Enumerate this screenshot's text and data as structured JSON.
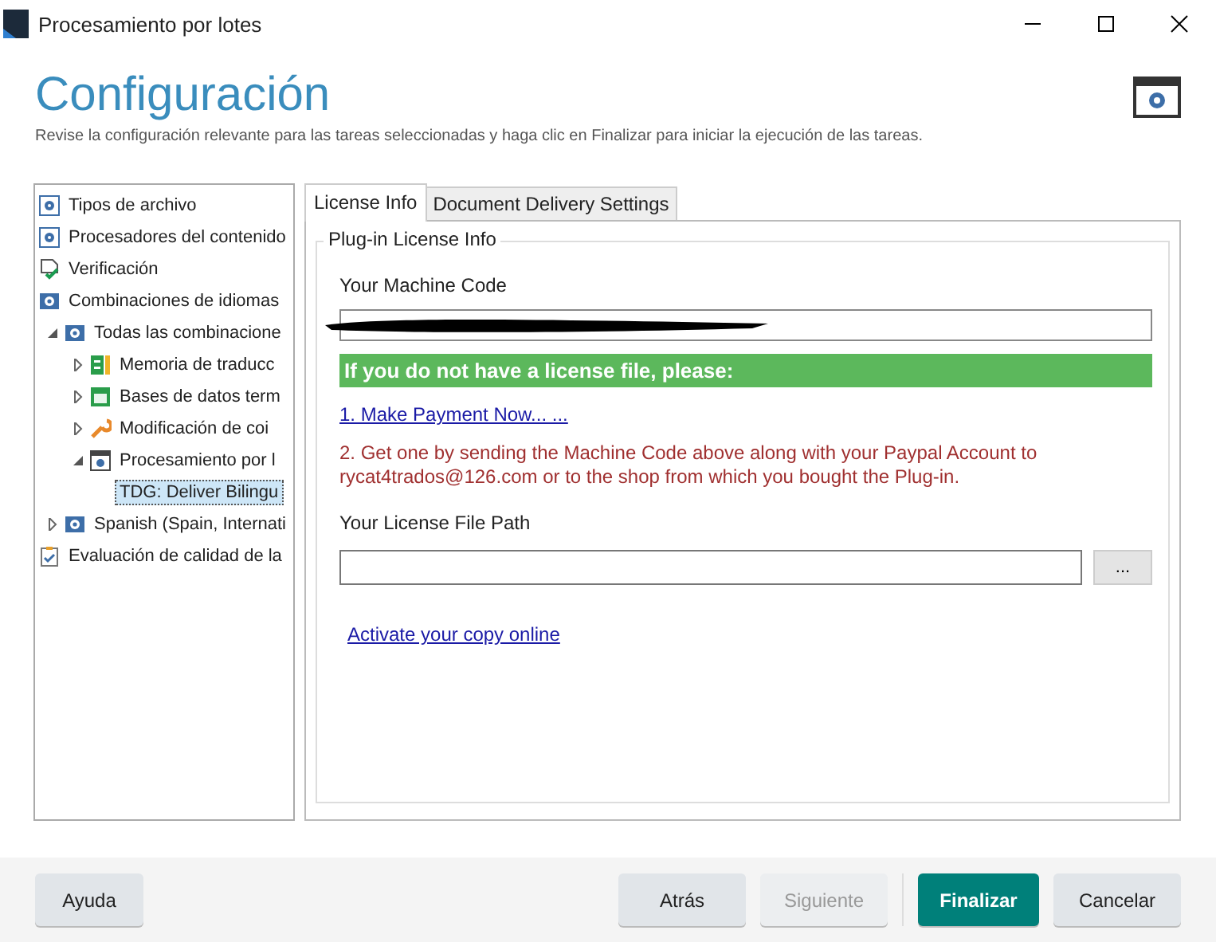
{
  "window": {
    "title": "Procesamiento por lotes"
  },
  "header": {
    "title": "Configuración",
    "subtitle": "Revise la configuración relevante para las tareas seleccionadas y haga clic en Finalizar para iniciar la ejecución de las tareas."
  },
  "tree": [
    {
      "label": "Tipos de archivo",
      "kind": "gear-doc",
      "selected": false
    },
    {
      "label": "Procesadores del contenido",
      "kind": "gear-doc",
      "selected": false
    },
    {
      "label": "Verificación",
      "kind": "check-doc",
      "selected": false
    },
    {
      "label": "Combinaciones de idiomas",
      "kind": "globe",
      "selected": false,
      "children": [
        {
          "label": "Todas las combinacione",
          "kind": "globe",
          "selected": false,
          "expanded": true,
          "children": [
            {
              "label": "Memoria de traducc",
              "kind": "tm",
              "selected": false,
              "expanded": false
            },
            {
              "label": "Bases de datos term",
              "kind": "termbase",
              "selected": false,
              "expanded": false
            },
            {
              "label": "Modificación de coi",
              "kind": "wrench",
              "selected": false,
              "expanded": false
            },
            {
              "label": "Procesamiento por l",
              "kind": "gear-window",
              "selected": false,
              "expanded": true,
              "children": [
                {
                  "label": "TDG: Deliver Bilingu",
                  "selected": true
                }
              ]
            }
          ]
        },
        {
          "label": "Spanish (Spain, Internati",
          "kind": "globe",
          "selected": false,
          "expanded": false
        }
      ]
    },
    {
      "label": "Evaluación de calidad de la",
      "kind": "qa",
      "selected": false
    }
  ],
  "tabs": [
    {
      "label": "License Info",
      "selected": true
    },
    {
      "label": "Document Delivery Settings",
      "selected": false
    }
  ],
  "group": {
    "title": "Plug-in License Info",
    "machine_code_label": "Your Machine Code",
    "banner": "If you do not have a license file, please:",
    "payment_link": "1. Make Payment Now... ...",
    "instructions": "2. Get one by sending the Machine Code above along with your Paypal Account to rycat4trados@126.com or to the shop from which you bought the Plug-in.",
    "license_path_label": "Your License File Path",
    "browse_button": "...",
    "activate_link": "Activate your copy online"
  },
  "footer": {
    "buttons": [
      {
        "label": "Ayuda",
        "kind": "default",
        "disabled": false
      },
      {
        "label": "Atrás",
        "kind": "default",
        "disabled": false
      },
      {
        "label": "Siguiente",
        "kind": "default",
        "disabled": true
      },
      {
        "label": "Finalizar",
        "kind": "primary",
        "disabled": false
      },
      {
        "label": "Cancelar",
        "kind": "default",
        "disabled": false
      }
    ]
  }
}
